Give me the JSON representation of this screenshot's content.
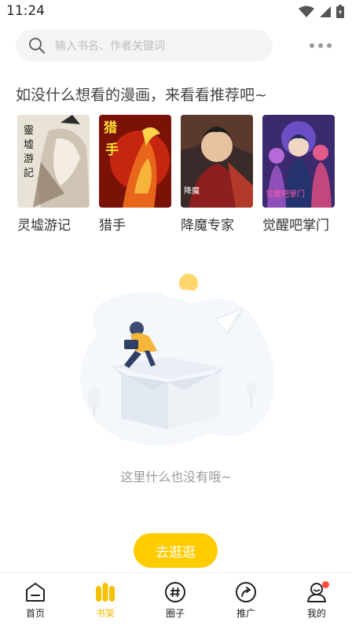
{
  "status_bar": {
    "time": "11:24"
  },
  "search": {
    "placeholder": "输入书名、作者关键词"
  },
  "recommend": {
    "title": "如没什么想看的漫画，来看看推荐吧~",
    "books": [
      {
        "title": "灵墟游记",
        "cover_text": "靈墟游記"
      },
      {
        "title": "猎手",
        "cover_text": "猎手"
      },
      {
        "title": "降魔专家",
        "cover_text": "降魔"
      },
      {
        "title": "觉醒吧掌门",
        "cover_text": "觉醒吧掌门"
      }
    ]
  },
  "empty_state": {
    "text": "这里什么也没有哦~"
  },
  "go_button": {
    "label": "去逛逛"
  },
  "tabs": [
    {
      "label": "首页",
      "icon": "home-icon"
    },
    {
      "label": "书架",
      "icon": "bookshelf-icon",
      "active": true
    },
    {
      "label": "圈子",
      "icon": "hashtag-icon"
    },
    {
      "label": "推广",
      "icon": "share-icon"
    },
    {
      "label": "我的",
      "icon": "profile-icon",
      "badge": true
    }
  ],
  "colors": {
    "accent": "#ffcc00",
    "active_tab": "#f5b800",
    "badge": "#ff4b3a"
  }
}
